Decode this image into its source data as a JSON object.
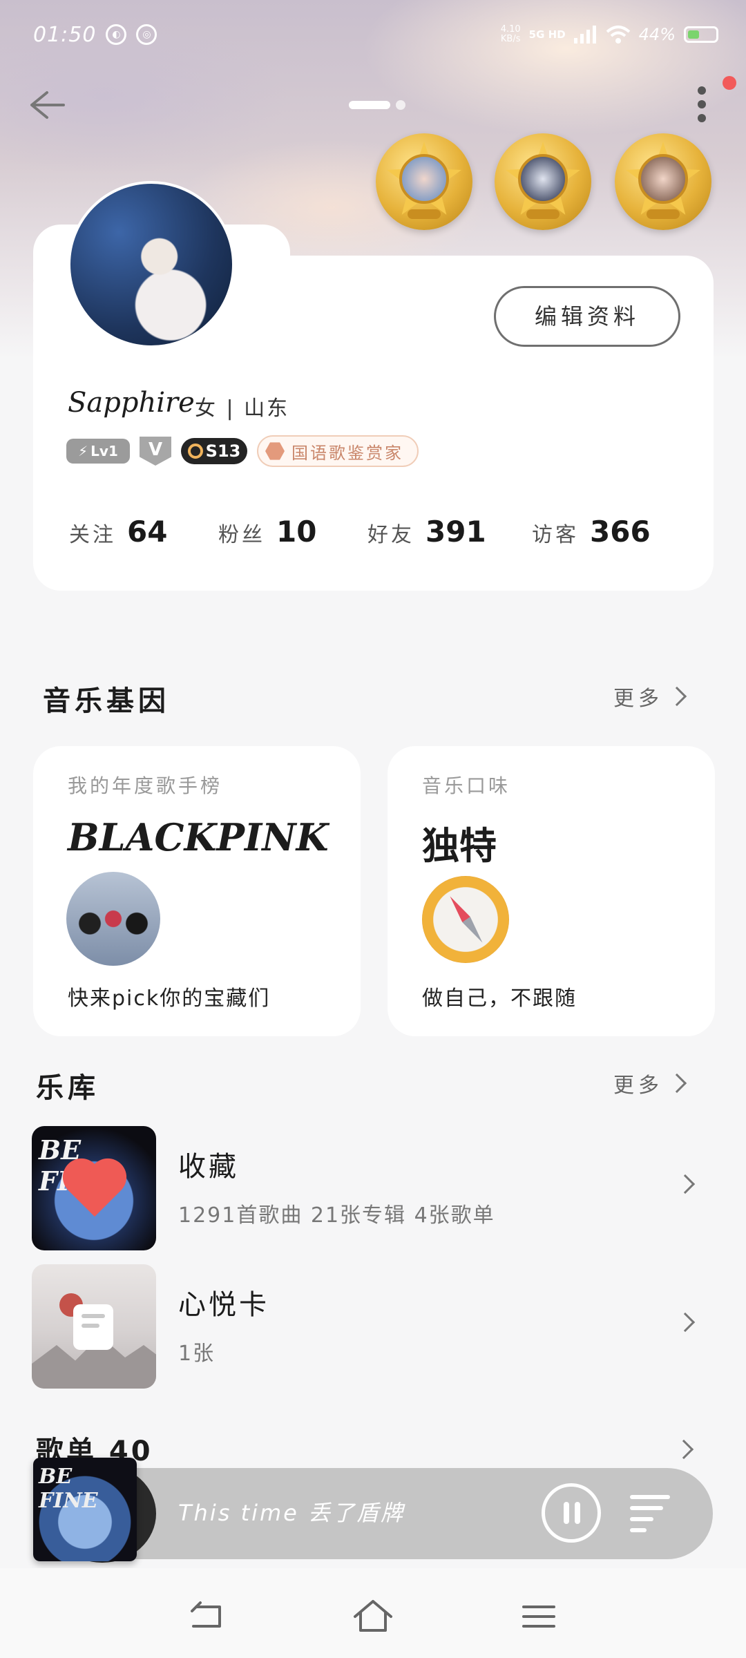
{
  "status_bar": {
    "time": "01:50",
    "speed_value": "4.10",
    "speed_unit": "KB/s",
    "network": "5G HD",
    "battery_percent": "44%",
    "battery_level": 0.44
  },
  "profile": {
    "name": "Sapphire",
    "info": "女 | 山东",
    "edit_label": "编辑资料",
    "level_badge": "Lv1",
    "vip_badge": "V",
    "season_badge": "S13",
    "honor_badge": "国语歌鉴赏家",
    "stats": [
      {
        "label": "关注",
        "value": "64"
      },
      {
        "label": "粉丝",
        "value": "10"
      },
      {
        "label": "好友",
        "value": "391"
      },
      {
        "label": "访客",
        "value": "366"
      }
    ]
  },
  "music_gene": {
    "title": "音乐基因",
    "more": "更多",
    "cards": [
      {
        "label": "我的年度歌手榜",
        "value": "BLACKPINK",
        "desc": "快来pick你的宝藏们"
      },
      {
        "label": "音乐口味",
        "value": "独特",
        "desc": "做自己，不跟随"
      }
    ]
  },
  "library": {
    "title": "乐库",
    "more": "更多",
    "items": [
      {
        "title": "收藏",
        "subtitle": "1291首歌曲 21张专辑 4张歌单",
        "cover_text": "BE FINE"
      },
      {
        "title": "心悦卡",
        "subtitle": "1张"
      }
    ]
  },
  "playlists": {
    "title": "歌单 40"
  },
  "player": {
    "song": "This time 丢了盾牌",
    "cover_text": "BE FINE"
  },
  "colors": {
    "accent_red": "#f25a5a",
    "honor_text": "#c9866a",
    "medal_gold": "#e6b23a"
  },
  "icons": {
    "back": "arrow-left-icon",
    "menu": "more-vertical-icon",
    "pause": "pause-icon",
    "queue": "playlist-icon",
    "nav_back": "nav-back-icon",
    "nav_home": "nav-home-icon",
    "nav_menu": "nav-menu-icon"
  }
}
